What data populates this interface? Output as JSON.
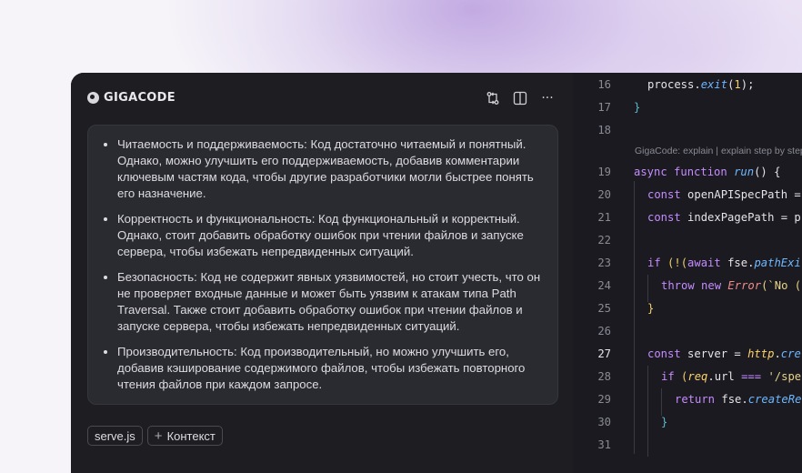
{
  "chat": {
    "logo_text": "GIGACODE",
    "header_icons": [
      "git-compare-icon",
      "split-panel-icon",
      "more-icon"
    ],
    "more_label": "···",
    "message_items": [
      "Читаемость и поддерживаемость: Код достаточно читаемый и понятный. Однако, можно улучшить его поддерживаемость, добавив комментарии ключевым частям кода, чтобы другие разработчики могли быстрее понять его назначение.",
      "Корректность и функциональность: Код функциональный и корректный. Однако, стоит добавить обработку ошибок при чтении файлов и запуске сервера, чтобы избежать непредвиденных ситуаций.",
      "Безопасность: Код не содержит явных уязвимостей, но стоит учесть, что он не проверяет входные данные и может быть уязвим к атакам типа Path Traversal. Также стоит добавить обработку ошибок при чтении файлов и запуске сервера, чтобы избежать непредвиденных ситуаций.",
      "Производительность: Код производительный, но можно улучшить его, добавив кэширование содержимого файлов, чтобы избежать повторного чтения файлов при каждом запросе."
    ],
    "chips": {
      "file": "serve.js",
      "context": "Контекст",
      "plus": "+"
    }
  },
  "editor": {
    "line_numbers": [
      "16",
      "17",
      "18",
      "19",
      "20",
      "21",
      "22",
      "23",
      "24",
      "25",
      "26",
      "27",
      "28",
      "29",
      "30",
      "31"
    ],
    "active_line": "27",
    "code_lens": "GigaCode: explain | explain step by step",
    "tokens": {
      "l16_a": "process.",
      "l16_b": "exit",
      "l16_c": "(",
      "l16_d": "1",
      "l16_e": ");",
      "l17": "}",
      "l19_kw1": "async",
      "l19_kw2": "function",
      "l19_fn": "run",
      "l19_rest": "() {",
      "l20_kw": "const",
      "l20_rest": "openAPISpecPath =",
      "l21_kw": "const",
      "l21_rest": "indexPagePath = p",
      "l23_kw": "if",
      "l23_a": "(!(",
      "l23_kw2": "await",
      "l23_b": "fse.",
      "l23_fn": "pathExi",
      "l24_kw": "throw",
      "l24_kw2": "new",
      "l24_err": "Error",
      "l24_str": "(`No (",
      "l25": "}",
      "l27_kw": "const",
      "l27_a": "server =",
      "l27_var": "http",
      "l27_b": ".",
      "l27_fn": "cre",
      "l28_kw": "if",
      "l28_a": "(",
      "l28_var": "req",
      "l28_b": ".url",
      "l28_op": "===",
      "l28_str": "'/spe",
      "l29_kw": "return",
      "l29_a": "fse.",
      "l29_fn": "createRe",
      "l30": "}"
    }
  },
  "colors": {
    "background": "#f6f4f9",
    "panel": "#1d1d22",
    "message_bubble": "#2a2a31",
    "keyword": "#c58cff",
    "function": "#6fb8ff",
    "number": "#f2d06b"
  }
}
